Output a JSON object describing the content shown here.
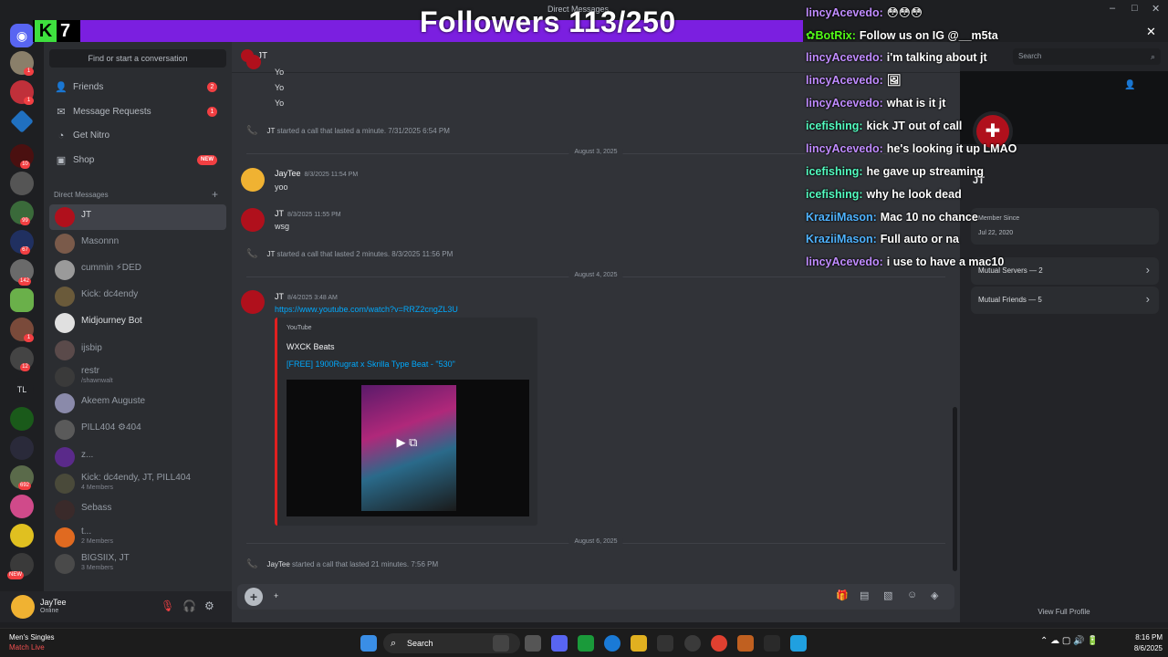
{
  "window": {
    "title": "Direct Messages",
    "controls": [
      "–",
      "□",
      "✕"
    ]
  },
  "overlay_banner": {
    "brand_k": "K",
    "brand_num": "7",
    "followers": "Followers 113/250"
  },
  "search_placeholder": "Find or start a conversation",
  "nav": {
    "friends": "Friends",
    "friends_count": "2",
    "requests": "Message Requests",
    "requests_count": "1",
    "nitro": "Get Nitro",
    "shop": "Shop",
    "shop_badge": "NEW"
  },
  "dm_header": "Direct Messages",
  "dms": [
    {
      "name": "JT",
      "sub": ""
    },
    {
      "name": "Masonnn",
      "sub": ""
    },
    {
      "name": "cummin ⚡DED",
      "sub": ""
    },
    {
      "name": "Kick: dc4endy",
      "sub": ""
    },
    {
      "name": "Midjourney Bot",
      "sub": ""
    },
    {
      "name": "ijsbip",
      "sub": ""
    },
    {
      "name": "restr",
      "sub": "/shawnwalt"
    },
    {
      "name": "Akeem Auguste",
      "sub": ""
    },
    {
      "name": "PILL404 ⚙404",
      "sub": ""
    },
    {
      "name": "z...",
      "sub": ""
    },
    {
      "name": "Kick: dc4endy, JT, PILL404",
      "sub": "4 Members"
    },
    {
      "name": "Sebass",
      "sub": ""
    },
    {
      "name": "t...",
      "sub": "2 Members"
    },
    {
      "name": "BIGSIIX, JT",
      "sub": "3 Members"
    }
  ],
  "user": {
    "name": "JayTee",
    "status": "Online"
  },
  "chat": {
    "header_name": "JT",
    "msg_yo1": "Yo",
    "msg_yo2": "Yo",
    "msg_yo3": "Yo",
    "call1": {
      "who": "JT",
      "text": "started a call that lasted a minute.",
      "ts": "7/31/2025 6:54 PM"
    },
    "sep1": "August 3, 2025",
    "m1": {
      "name": "JayTee",
      "ts": "8/3/2025 11:54 PM",
      "text": "yoo"
    },
    "m2": {
      "name": "JT",
      "ts": "8/3/2025 11:55 PM",
      "text": "wsg"
    },
    "call2": {
      "who": "JT",
      "text": "started a call that lasted 2 minutes.",
      "ts": "8/3/2025 11:56 PM"
    },
    "sep2": "August 4, 2025",
    "m3": {
      "name": "JT",
      "ts": "8/4/2025 3:48 AM",
      "link": "https://www.youtube.com/watch?v=RRZ2cngZL3U"
    },
    "embed": {
      "provider": "YouTube",
      "author": "WXCK Beats",
      "title": "[FREE] 1900Rugrat x Skrilla Type Beat - \"530\""
    },
    "sep3": "August 6, 2025",
    "call3": {
      "who": "JayTee",
      "text": "started a call that lasted 21 minutes.",
      "ts": "7:56 PM"
    },
    "composer_text": "+"
  },
  "profile": {
    "search": "Search",
    "name": "JT",
    "member_since_label": "Member Since",
    "member_since": "Jul 22, 2020",
    "mutual_servers": "Mutual Servers — 2",
    "mutual_friends": "Mutual Friends — 5",
    "view_full": "View Full Profile"
  },
  "overlay_chat": [
    {
      "user": "lincyAcevedo:",
      "msg": "😳😳😳",
      "color": "#c08cff"
    },
    {
      "user": "✿BotRix:",
      "msg": "Follow us on IG @__m5ta",
      "color": "#53fc18"
    },
    {
      "user": "lincyAcevedo:",
      "msg": "i'm talking about jt",
      "color": "#c08cff"
    },
    {
      "user": "lincyAcevedo:",
      "msg": "🖼",
      "color": "#c08cff"
    },
    {
      "user": "lincyAcevedo:",
      "msg": "what is it jt",
      "color": "#c08cff"
    },
    {
      "user": "icefishing:",
      "msg": "kick JT out of call",
      "color": "#53fcc0"
    },
    {
      "user": "lincyAcevedo:",
      "msg": "he's looking it up LMAO",
      "color": "#c08cff"
    },
    {
      "user": "icefishing:",
      "msg": "he gave up streaming",
      "color": "#53fcc0"
    },
    {
      "user": "icefishing:",
      "msg": "why he look dead",
      "color": "#53fcc0"
    },
    {
      "user": "KraziiMason:",
      "msg": "Mac 10 no chance",
      "color": "#4fb3ff"
    },
    {
      "user": "KraziiMason:",
      "msg": "Full auto or na",
      "color": "#4fb3ff"
    },
    {
      "user": "lincyAcevedo:",
      "msg": "i use to have a mac10",
      "color": "#c08cff"
    }
  ],
  "taskbar": {
    "news_title": "Men's Singles",
    "news_sub": "Match Live",
    "search": "Search",
    "time": "8:16 PM",
    "date": "8/6/2025"
  },
  "colors": {
    "banner": "#7b1fe0",
    "discord_blurple": "#5865f2",
    "red": "#f23f42",
    "green": "#23a55a",
    "link": "#00a8fc"
  }
}
